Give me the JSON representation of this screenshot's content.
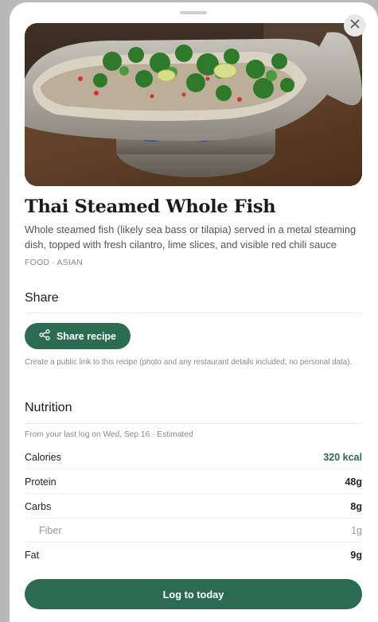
{
  "recipe": {
    "title": "Thai Steamed Whole Fish",
    "description": "Whole steamed fish (likely sea bass or tilapia) served in a metal steaming dish, topped with fresh cilantro, lime slices, and visible red chili sauce",
    "category": "FOOD · ASIAN"
  },
  "share": {
    "heading": "Share",
    "button_label": "Share recipe",
    "note": "Create a public link to this recipe (photo and any restaurant details included; no personal data)."
  },
  "nutrition": {
    "heading": "Nutrition",
    "meta": "From your last log on Wed, Sep 16 · Estimated",
    "rows": [
      {
        "label": "Calories",
        "value": "320 kcal"
      },
      {
        "label": "Protein",
        "value": "48g"
      },
      {
        "label": "Carbs",
        "value": "8g"
      },
      {
        "label": "Fiber",
        "value": "1g"
      },
      {
        "label": "Fat",
        "value": "9g"
      }
    ]
  },
  "actions": {
    "log_label": "Log to today"
  },
  "icons": {
    "close": "close-icon",
    "share": "share-icon"
  },
  "colors": {
    "accent": "#2b6b51",
    "sheet": "#ffffff",
    "backdrop": "#b9b9b9"
  }
}
